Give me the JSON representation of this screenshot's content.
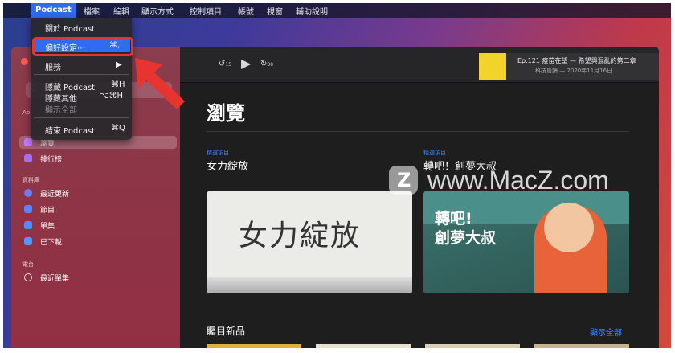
{
  "menubar": {
    "app": "Podcast",
    "items": [
      "檔案",
      "編輯",
      "顯示方式",
      "控制項目",
      "帳號",
      "視窗",
      "輔助說明"
    ]
  },
  "app_menu": {
    "about": "關於 Podcast",
    "preferences": "偏好設定⋯",
    "preferences_shortcut": "⌘,",
    "services": "服務",
    "hide": "隱藏 Podcast",
    "hide_shortcut": "⌘H",
    "hide_others": "隱藏其他",
    "hide_others_shortcut": "⌥⌘H",
    "show_all": "顯示全部",
    "quit": "結束 Podcast",
    "quit_shortcut": "⌘Q"
  },
  "sidebar": {
    "search_placeholder": "Q",
    "section_apple": "Ap",
    "items_top": [
      {
        "label": "瀏覽",
        "icon": "podcast-icon"
      },
      {
        "label": "排行榜",
        "icon": "charts-icon"
      }
    ],
    "section_library": "資料庫",
    "library": [
      {
        "label": "最近更新",
        "icon": "clock-icon"
      },
      {
        "label": "節目",
        "icon": "shows-icon"
      },
      {
        "label": "單集",
        "icon": "episodes-icon"
      },
      {
        "label": "已下載",
        "icon": "download-icon"
      }
    ],
    "section_station": "電台",
    "station": [
      {
        "label": "最近單集",
        "icon": "station-icon"
      }
    ]
  },
  "toolbar": {
    "skip_back": "15",
    "skip_forward": "30",
    "now_playing_title": "Ep.121 疫苗在望 — 希望與混亂的第二章",
    "now_playing_sub": "科技島讀 — 2020年11月16日"
  },
  "browse": {
    "title": "瀏覽",
    "card1_kicker": "精選項目",
    "card1_title": "女力綻放",
    "card1_art": "女力綻放",
    "card2_kicker": "精選項目",
    "card2_title": "轉吧！創夢大叔",
    "card2_art_l1": "轉吧!",
    "card2_art_l2": "創夢大叔",
    "new_section": "矚目新品",
    "show_all": "顯示全部"
  },
  "watermark": {
    "logo": "Z",
    "text": "www.MacZ.com"
  }
}
